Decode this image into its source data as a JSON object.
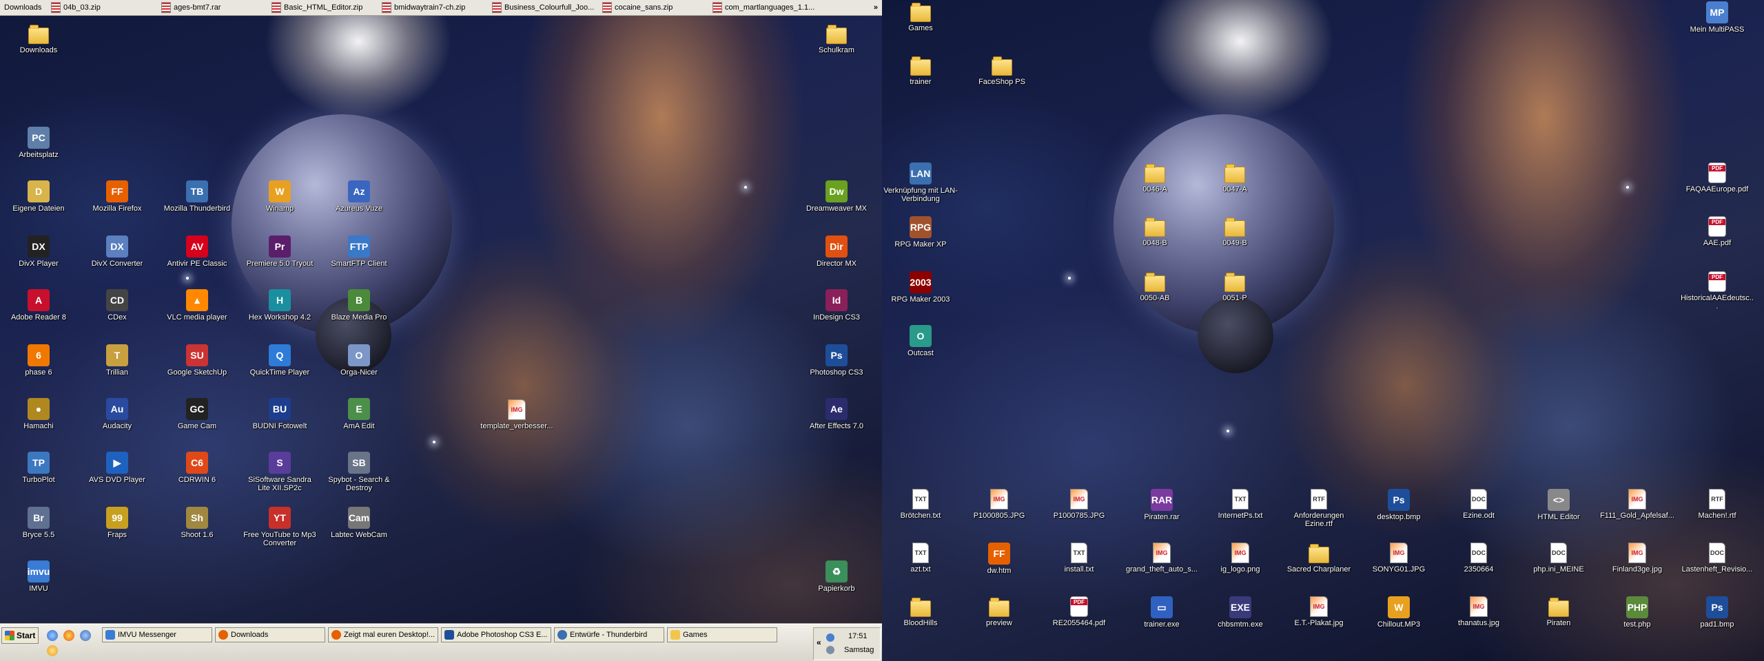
{
  "downloads_bar": {
    "title": "Downloads",
    "items": [
      "04b_03.zip",
      "ages-bmt7.rar",
      "Basic_HTML_Editor.zip",
      "bmidwaytrain7-ch.zip",
      "Business_Colourfull_Joo...",
      "cocaine_sans.zip",
      "com_martlanguages_1.1..."
    ],
    "more": "»"
  },
  "left_icons": [
    {
      "label": "Downloads",
      "icon": "folder-icon"
    },
    {
      "label": "Schulkram",
      "icon": "folder-icon"
    },
    {
      "label": "Arbeitsplatz",
      "icon": "computer-icon"
    },
    {
      "label": "Eigene Dateien",
      "icon": "documents-icon"
    },
    {
      "label": "Mozilla Firefox",
      "icon": "firefox-icon"
    },
    {
      "label": "Mozilla Thunderbird",
      "icon": "thunderbird-icon"
    },
    {
      "label": "Winamp",
      "icon": "winamp-icon"
    },
    {
      "label": "Azureus Vuze",
      "icon": "azureus-icon"
    },
    {
      "label": "Dreamweaver MX",
      "icon": "dreamweaver-icon"
    },
    {
      "label": "DivX Player",
      "icon": "divx-icon"
    },
    {
      "label": "DivX Converter",
      "icon": "divx-converter-icon"
    },
    {
      "label": "Antivir PE Classic",
      "icon": "antivir-icon"
    },
    {
      "label": "Premiere 5.0 Tryout",
      "icon": "premiere-icon"
    },
    {
      "label": "SmartFTP Client",
      "icon": "ftp-icon"
    },
    {
      "label": "Director MX",
      "icon": "director-icon"
    },
    {
      "label": "Adobe Reader 8",
      "icon": "adobe-reader-icon"
    },
    {
      "label": "CDex",
      "icon": "cdex-icon"
    },
    {
      "label": "VLC media player",
      "icon": "vlc-icon"
    },
    {
      "label": "Hex Workshop 4.2",
      "icon": "hex-workshop-icon"
    },
    {
      "label": "Blaze Media Pro",
      "icon": "blaze-icon"
    },
    {
      "label": "InDesign CS3",
      "icon": "indesign-icon"
    },
    {
      "label": "phase 6",
      "icon": "phase6-icon"
    },
    {
      "label": "Trillian",
      "icon": "trillian-icon"
    },
    {
      "label": "Google SketchUp",
      "icon": "sketchup-icon"
    },
    {
      "label": "QuickTime Player",
      "icon": "quicktime-icon"
    },
    {
      "label": "Orga-Nicer",
      "icon": "organizer-icon"
    },
    {
      "label": "Photoshop CS3",
      "icon": "photoshop-icon"
    },
    {
      "label": "Hamachi",
      "icon": "hamachi-icon"
    },
    {
      "label": "Audacity",
      "icon": "audacity-icon"
    },
    {
      "label": "Game Cam",
      "icon": "gamecam-icon"
    },
    {
      "label": "BUDNI Fotowelt",
      "icon": "budni-icon"
    },
    {
      "label": "AmA Edit",
      "icon": "edit-icon"
    },
    {
      "label": "template_verbesser...",
      "icon": "image-file-icon"
    },
    {
      "label": "After Effects 7.0",
      "icon": "after-effects-icon"
    },
    {
      "label": "TurboPlot",
      "icon": "turboplot-icon"
    },
    {
      "label": "AVS DVD Player",
      "icon": "dvd-player-icon"
    },
    {
      "label": "CDRWIN 6",
      "icon": "cdrwin-icon"
    },
    {
      "label": "SiSoftware Sandra Lite XII.SP2c",
      "icon": "sandra-icon"
    },
    {
      "label": "Spybot - Search & Destroy",
      "icon": "spybot-icon"
    },
    {
      "label": "Bryce 5.5",
      "icon": "bryce-icon"
    },
    {
      "label": "Fraps",
      "icon": "fraps-icon"
    },
    {
      "label": "Shoot 1.6",
      "icon": "shoot-icon"
    },
    {
      "label": "Free YouTube to Mp3 Converter",
      "icon": "youtube-converter-icon"
    },
    {
      "label": "Labtec WebCam",
      "icon": "webcam-icon"
    },
    {
      "label": "IMVU",
      "icon": "imvu-icon"
    },
    {
      "label": "Papierkorb",
      "icon": "recycle-bin-icon"
    }
  ],
  "right_icons": [
    {
      "label": "Games",
      "icon": "folder-icon"
    },
    {
      "label": "Mein MultiPASS",
      "icon": "multipass-icon"
    },
    {
      "label": "trainer",
      "icon": "folder-icon"
    },
    {
      "label": "FaceShop PS",
      "icon": "folder-icon"
    },
    {
      "label": "Verknüpfung mit LAN-Verbindung",
      "icon": "network-icon"
    },
    {
      "label": "0046-A",
      "icon": "folder-icon"
    },
    {
      "label": "0047-A",
      "icon": "folder-icon"
    },
    {
      "label": "FAQAAEurope.pdf",
      "icon": "pdf-icon"
    },
    {
      "label": "RPG Maker XP",
      "icon": "rpg-maker-icon"
    },
    {
      "label": "0048-B",
      "icon": "folder-icon"
    },
    {
      "label": "0049-B",
      "icon": "folder-icon"
    },
    {
      "label": "AAE.pdf",
      "icon": "pdf-icon"
    },
    {
      "label": "RPG Maker 2003",
      "icon": "rpg-maker-2003-icon"
    },
    {
      "label": "0050-AB",
      "icon": "folder-icon"
    },
    {
      "label": "0051-P",
      "icon": "folder-icon"
    },
    {
      "label": "HistoricalAAEdeutsc...",
      "icon": "pdf-icon"
    },
    {
      "label": "Outcast",
      "icon": "outcast-icon"
    },
    {
      "label": "Brötchen.txt",
      "icon": "text-file-icon"
    },
    {
      "label": "P1000805.JPG",
      "icon": "image-file-icon"
    },
    {
      "label": "P1000785.JPG",
      "icon": "image-file-icon"
    },
    {
      "label": "Piraten.rar",
      "icon": "rar-icon"
    },
    {
      "label": "InternetPs.txt",
      "icon": "text-file-icon"
    },
    {
      "label": "Anforderungen Ezine.rtf",
      "icon": "rtf-icon"
    },
    {
      "label": "desktop.bmp",
      "icon": "photoshop-file-icon"
    },
    {
      "label": "Ezine.odt",
      "icon": "document-icon"
    },
    {
      "label": "HTML Editor",
      "icon": "html-editor-icon"
    },
    {
      "label": "F111_Gold_Apfelsaf...",
      "icon": "image-file-icon"
    },
    {
      "label": "Machen!.rtf",
      "icon": "rtf-icon"
    },
    {
      "label": "azt.txt",
      "icon": "text-file-icon"
    },
    {
      "label": "dw.htm",
      "icon": "firefox-doc-icon"
    },
    {
      "label": "install.txt",
      "icon": "text-file-icon"
    },
    {
      "label": "grand_theft_auto_s...",
      "icon": "image-file-icon"
    },
    {
      "label": "ig_logo.png",
      "icon": "image-file-icon"
    },
    {
      "label": "Sacred Charplaner",
      "icon": "folder-icon"
    },
    {
      "label": "SONYG01.JPG",
      "icon": "image-file-icon"
    },
    {
      "label": "2350664",
      "icon": "document-icon"
    },
    {
      "label": "php.ini_MEINE",
      "icon": "document-icon"
    },
    {
      "label": "Finland3ge.jpg",
      "icon": "image-file-icon"
    },
    {
      "label": "Lastenheft_Revisio...",
      "icon": "document-icon"
    },
    {
      "label": "BloodHills",
      "icon": "folder-icon"
    },
    {
      "label": "preview",
      "icon": "folder-icon"
    },
    {
      "label": "RE2055464.pdf",
      "icon": "pdf-icon"
    },
    {
      "label": "trainer.exe",
      "icon": "window-icon"
    },
    {
      "label": "chbsmtm.exe",
      "icon": "exe-icon"
    },
    {
      "label": "E.T.-Plakat.jpg",
      "icon": "image-file-icon"
    },
    {
      "label": "Chillout.MP3",
      "icon": "winamp-icon"
    },
    {
      "label": "thanatus.jpg",
      "icon": "image-file-icon"
    },
    {
      "label": "Piraten",
      "icon": "folder-icon"
    },
    {
      "label": "test.php",
      "icon": "php-file-icon"
    },
    {
      "label": "pad1.bmp",
      "icon": "photoshop-file-icon"
    }
  ],
  "taskbar": {
    "start_label": "Start",
    "buttons": [
      "IMVU Messenger",
      "Downloads",
      "Zeigt mal euren Desktop!...",
      "Adobe Photoshop CS3 E...",
      "Entwürfe - Thunderbird",
      "Games"
    ],
    "tray_chevron": "«",
    "clock": "17:51",
    "day": "Samstag"
  },
  "colors": {
    "firefox": "#e66000",
    "thunderbird": "#3a6fb0",
    "winamp": "#e8a020",
    "azureus": "#3a66c0",
    "dreamweaver": "#6aa120",
    "divx": "#222222",
    "antivir": "#d6001c",
    "premiere": "#5b1e6b",
    "director": "#e05010",
    "adobe_reader": "#c8102e",
    "indesign": "#8a1f5a",
    "photoshop": "#1e4e9a",
    "vlc": "#ff8800",
    "after_effects": "#2b2b6e",
    "hamachi": "#ffcc33"
  }
}
